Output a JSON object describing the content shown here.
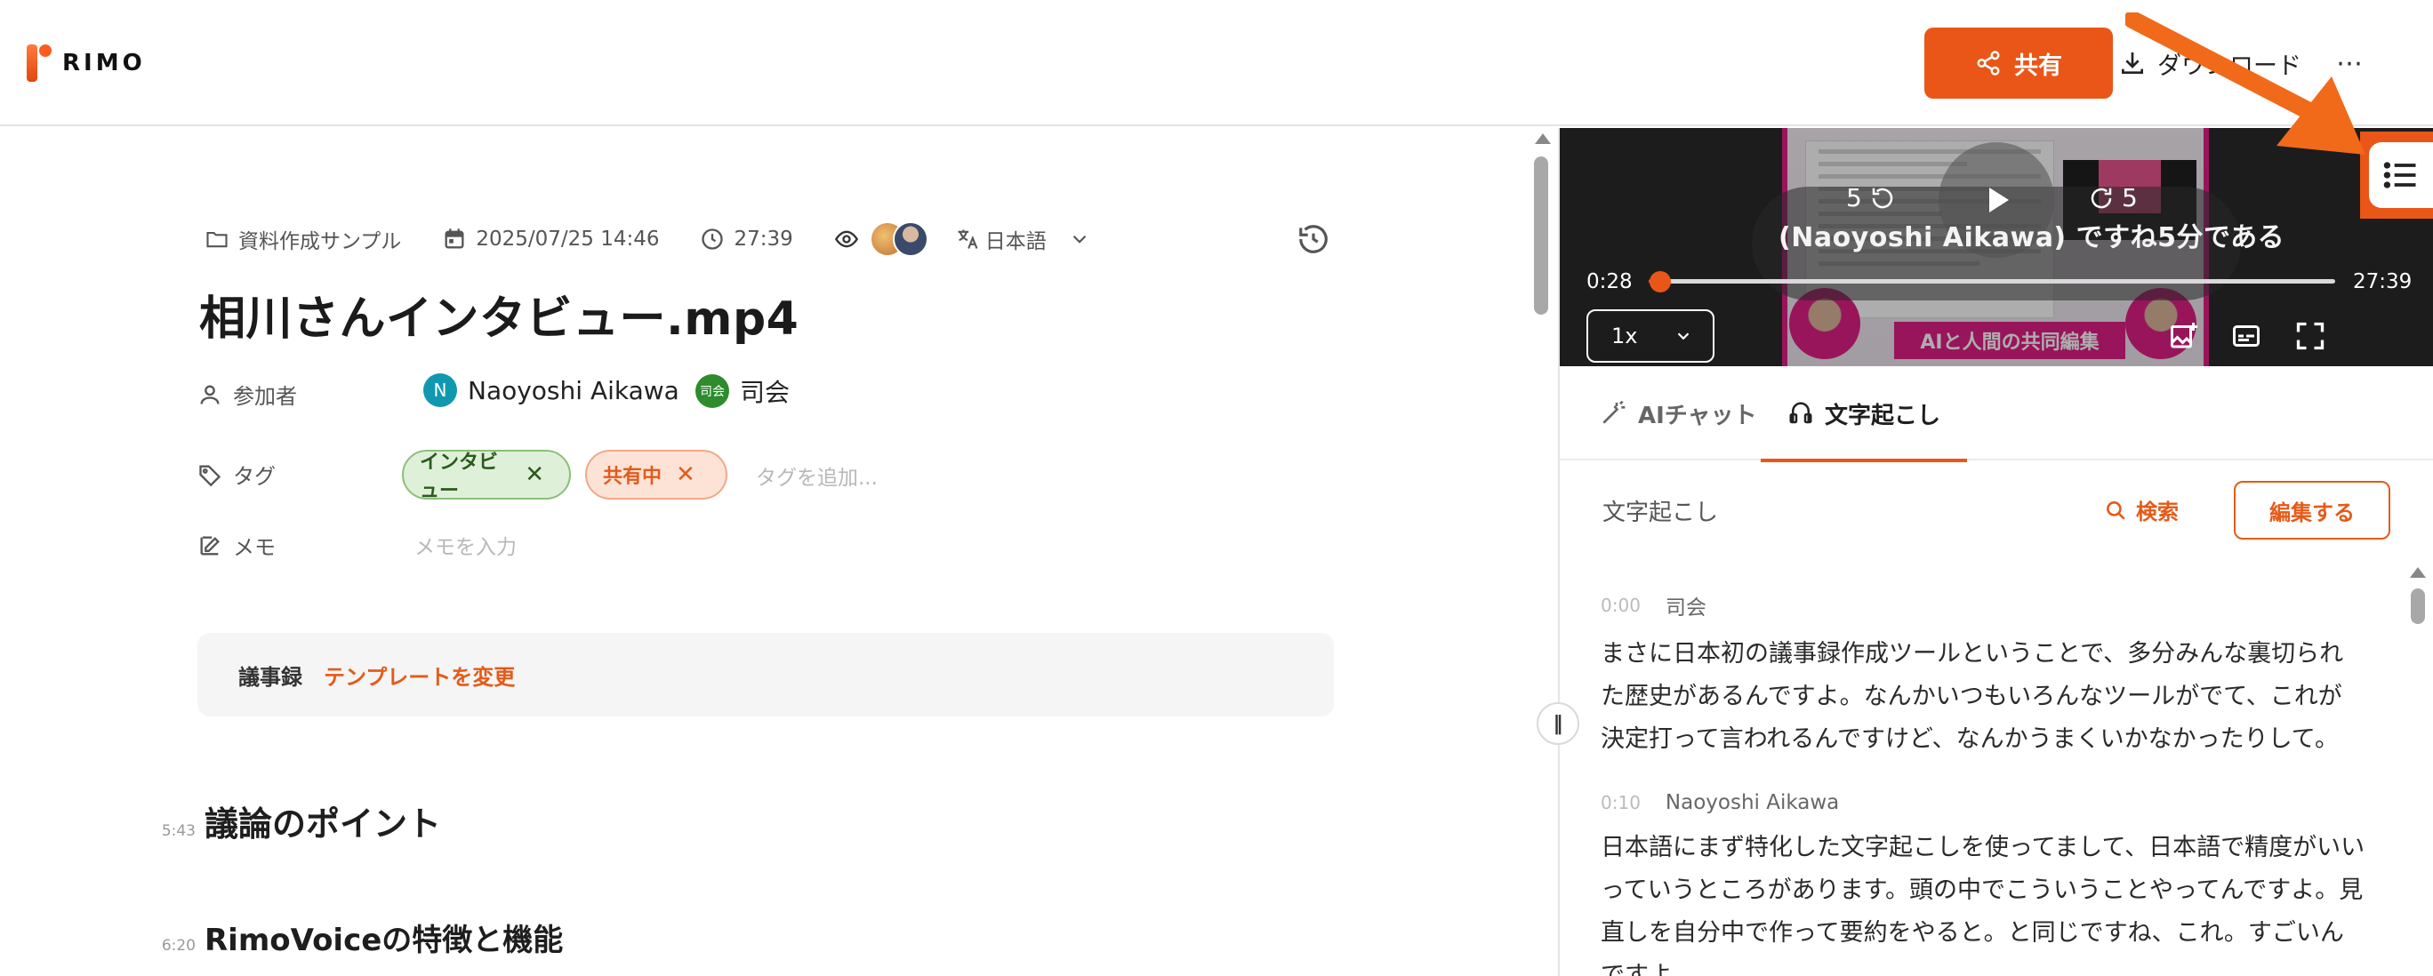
{
  "header": {
    "logo_text": "RIMO",
    "share_label": "共有",
    "download_label": "ダウンロード",
    "more_label": "⋯"
  },
  "meta": {
    "folder": "資料作成サンプル",
    "date": "2025/07/25 14:46",
    "duration": "27:39",
    "language": "日本語"
  },
  "title": "相川さんインタビュー.mp4",
  "fields": {
    "participants_label": "参加者",
    "tags_label": "タグ",
    "memo_label": "メモ",
    "participants": [
      {
        "initial": "N",
        "name": "Naoyoshi Aikawa"
      },
      {
        "initial": "司会",
        "name": "司会"
      }
    ],
    "tags": [
      {
        "label": "インタビュー"
      },
      {
        "label": "共有中"
      }
    ],
    "tag_add_placeholder": "タグを追加...",
    "memo_placeholder": "メモを入力"
  },
  "minutes": {
    "label": "議事録",
    "template_link": "テンプレートを変更"
  },
  "sections": [
    {
      "ts": "5:43",
      "heading": "議論のポイント"
    },
    {
      "ts": "6:20",
      "heading": "RimoVoiceの特徴と機能"
    }
  ],
  "video": {
    "current_time": "0:28",
    "duration": "27:39",
    "progress": 0.017,
    "caption": "(Naoyoshi Aikawa) ですね5分である",
    "skip_back": "5",
    "skip_forward": "5",
    "speed": "1x",
    "banner": "AIと人間の共同編集"
  },
  "tabs": {
    "ai_chat": "AIチャット",
    "transcript": "文字起こし"
  },
  "panel": {
    "heading": "文字起こし",
    "search_label": "検索",
    "edit_label": "編集する"
  },
  "transcript": [
    {
      "time": "0:00",
      "speaker": "司会",
      "text": "まさに日本初の議事録作成ツールということで、多分みんな裏切られた歴史があるんですよ。なんかいつもいろんなツールがでて、これが決定打って言われるんですけど、なんかうまくいかなかったりして。"
    },
    {
      "time": "0:10",
      "speaker": "Naoyoshi Aikawa",
      "text": "日本語にまず特化した文字起こしを使ってまして、日本語で精度がいいっていうところがあります。頭の中でこういうことやってんですよ。見直しを自分中で作って要約をやると。と同じですね、これ。すごいんですよ"
    }
  ],
  "colors": {
    "accent": "#ea5618",
    "tag_green_bg": "#dff0d8",
    "tag_orange_bg": "#fde3d6",
    "video_frame": "#e01f86"
  }
}
